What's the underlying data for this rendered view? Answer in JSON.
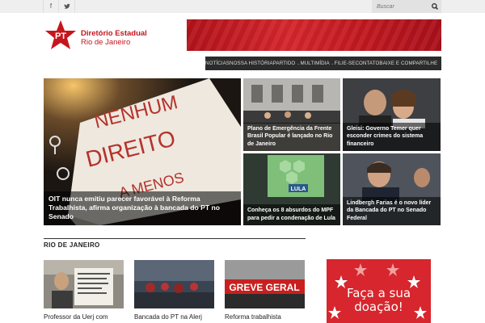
{
  "topbar": {
    "search_placeholder": "Buscar",
    "social": [
      "facebook-icon",
      "twitter-icon"
    ],
    "social_glyphs": [
      "f",
      "🐦"
    ]
  },
  "logo": {
    "mark": "PT",
    "title": "Diretório Estadual",
    "subtitle": "Rio de Janeiro",
    "brand_color": "#c4161c"
  },
  "nav": {
    "items": [
      {
        "label": "NOTÍCIAS",
        "dropdown": false
      },
      {
        "label": "NOSSA HISTÓRIA",
        "dropdown": false
      },
      {
        "label": "PARTIDO",
        "dropdown": true
      },
      {
        "label": "MULTIMÍDIA",
        "dropdown": true
      },
      {
        "label": "FILIE-SE",
        "dropdown": false
      },
      {
        "label": "CONTATO",
        "dropdown": false
      },
      {
        "label": "BAIXE E COMPARTILHE",
        "dropdown": false
      }
    ]
  },
  "featured": {
    "main": {
      "caption": "OIT nunca emitiu parecer favorável à Reforma Trabalhista, afirma organização à bancada do PT no Senado",
      "sign_lines": [
        "NENHUM",
        "DIREITO",
        "A MENOS"
      ]
    },
    "tiles": [
      {
        "caption": "Plano de Emergência da Frente Brasil Popular é lançado no Rio de Janeiro"
      },
      {
        "caption": "Gleisi: Governo Temer quer esconder crimes do sistema financeiro"
      },
      {
        "caption": "Conheça os 8 absurdos do MPF para pedir a condenação de Lula",
        "screen_label": "LULA"
      },
      {
        "caption": "Lindbergh Farias é o novo líder da Bancada do PT no Senado Federal"
      }
    ]
  },
  "section": {
    "title": "RIO DE JANEIRO",
    "items": [
      {
        "title": "Professor da Uerj com"
      },
      {
        "title": "Bancada do PT na Alerj"
      },
      {
        "title": "Reforma trabalhista",
        "image_text": "GREVE GERAL"
      }
    ]
  },
  "donate": {
    "line1": "Faça a sua",
    "line2": "doação!"
  }
}
